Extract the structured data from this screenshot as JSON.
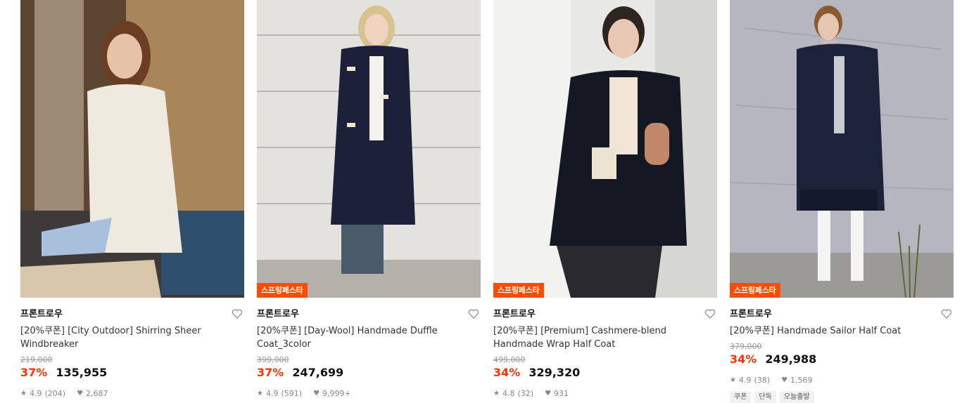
{
  "products": [
    {
      "badge": "",
      "brand": "프론트로우",
      "title": "[20%쿠폰] [City Outdoor] Shirring Sheer Windbreaker",
      "original_price": "219,000",
      "discount": "37%",
      "price": "135,955",
      "rating": "4.9",
      "review_count": "(204)",
      "likes": "2,687",
      "tags": []
    },
    {
      "badge": "스프링페스타",
      "brand": "프론트로우",
      "title": "[20%쿠폰] [Day-Wool] Handmade Duffle Coat_3color",
      "original_price": "399,000",
      "discount": "37%",
      "price": "247,699",
      "rating": "4.9",
      "review_count": "(591)",
      "likes": "9,999+",
      "tags": []
    },
    {
      "badge": "스프링페스타",
      "brand": "프론트로우",
      "title": "[20%쿠폰] [Premium] Cashmere-blend Handmade Wrap Half Coat",
      "original_price": "499,000",
      "discount": "34%",
      "price": "329,320",
      "rating": "4.8",
      "review_count": "(32)",
      "likes": "931",
      "tags": []
    },
    {
      "badge": "스프링페스타",
      "brand": "프론트로우",
      "title": "[20%쿠폰] Handmade Sailor Half Coat",
      "original_price": "379,000",
      "discount": "34%",
      "price": "249,988",
      "rating": "4.9",
      "review_count": "(38)",
      "likes": "1,569",
      "tags": [
        "쿠폰",
        "단독",
        "오늘출발"
      ]
    }
  ],
  "icons": {
    "like": "heart-outline-icon",
    "rating": "star-icon",
    "likes": "heart-filled-icon"
  },
  "colors": {
    "accent": "#ff4c00",
    "discount": "#ff3300"
  }
}
